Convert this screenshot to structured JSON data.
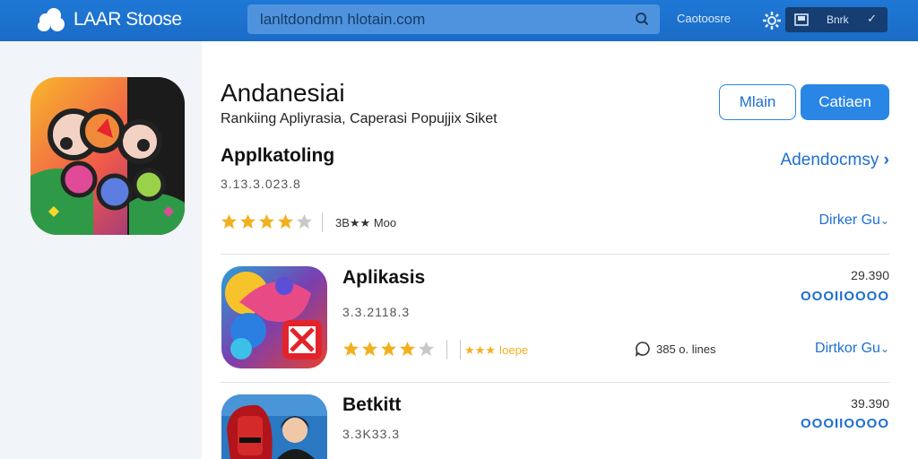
{
  "header": {
    "logo_text": "LAAR Stoose",
    "search_text": "lanltdondmn hlotain.com",
    "categories_label": "Caotoosre",
    "account_label": "Bnrk"
  },
  "hero": {
    "title": "Andanesiai",
    "subtitle": "Rankiing Apliyrasia, Caperasi Popujjix Siket",
    "category": "Applkatoling",
    "version": "3.13.3.023.8",
    "rating_text": "3B★★ Moo",
    "stars": 4,
    "btn_secondary": "Mlain",
    "btn_primary": "Catiaen",
    "more_link": "Adendocmsy",
    "download_link": "Dirker Gu"
  },
  "rows": [
    {
      "title": "Aplikasis",
      "version": "3.3.2118.3",
      "rating_text": "★★★ Ioepe",
      "stars": 4,
      "reviews": "385 o. lines",
      "price": "29.390",
      "badge": "OOOIIOOOO",
      "download_link": "Dirtkor Gu"
    },
    {
      "title": "Betkitt",
      "version": "3.3K33.3",
      "price": "39.390",
      "badge": "OOOIIOOOO"
    }
  ]
}
